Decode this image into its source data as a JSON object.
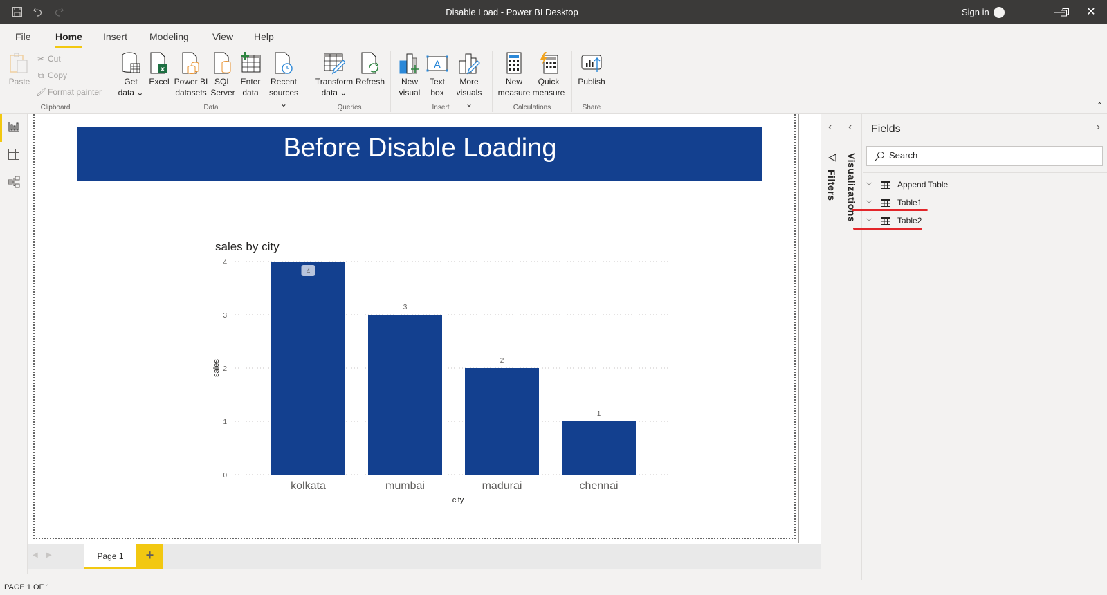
{
  "app": {
    "window_title": "Disable Load - Power BI Desktop",
    "sign_in": "Sign in",
    "quick_access": [
      "save-icon",
      "undo-icon",
      "redo-icon"
    ],
    "window_controls": {
      "minimize": "—",
      "restore": "❐",
      "close": "✕"
    }
  },
  "menu_tabs": [
    {
      "label": "File",
      "active": false
    },
    {
      "label": "Home",
      "active": true
    },
    {
      "label": "Insert",
      "active": false
    },
    {
      "label": "Modeling",
      "active": false
    },
    {
      "label": "View",
      "active": false
    },
    {
      "label": "Help",
      "active": false
    }
  ],
  "ribbon": {
    "clipboard": {
      "group_label": "Clipboard",
      "paste": "Paste",
      "cut": "Cut",
      "copy": "Copy",
      "format_painter": "Format painter"
    },
    "data": {
      "group_label": "Data",
      "buttons": [
        {
          "line1": "Get",
          "line2": "data ⌄"
        },
        {
          "line1": "Excel",
          "line2": ""
        },
        {
          "line1": "Power BI",
          "line2": "datasets"
        },
        {
          "line1": "SQL",
          "line2": "Server"
        },
        {
          "line1": "Enter",
          "line2": "data"
        },
        {
          "line1": "Recent",
          "line2": "sources ⌄"
        }
      ]
    },
    "queries": {
      "group_label": "Queries",
      "buttons": [
        {
          "line1": "Transform",
          "line2": "data ⌄"
        },
        {
          "line1": "Refresh",
          "line2": ""
        }
      ]
    },
    "insert": {
      "group_label": "Insert",
      "buttons": [
        {
          "line1": "New",
          "line2": "visual"
        },
        {
          "line1": "Text",
          "line2": "box"
        },
        {
          "line1": "More",
          "line2": "visuals ⌄"
        }
      ]
    },
    "calculations": {
      "group_label": "Calculations",
      "buttons": [
        {
          "line1": "New",
          "line2": "measure"
        },
        {
          "line1": "Quick",
          "line2": "measure"
        }
      ]
    },
    "share": {
      "group_label": "Share",
      "buttons": [
        {
          "line1": "Publish",
          "line2": ""
        }
      ]
    },
    "collapse": "⌃"
  },
  "left_nav": [
    "report-view-icon",
    "data-view-icon",
    "model-view-icon"
  ],
  "canvas": {
    "banner_text": "Before Disable Loading",
    "banner_color": "#13408f"
  },
  "chart_data": {
    "type": "bar",
    "title": "sales by city",
    "categories": [
      "kolkata",
      "mumbai",
      "madurai",
      "chennai"
    ],
    "values": [
      4,
      3,
      2,
      1
    ],
    "data_labels": [
      "4",
      "3",
      "2",
      "1"
    ],
    "xlabel": "city",
    "ylabel": "sales",
    "ylim": [
      0,
      4
    ],
    "yticks": [
      0,
      1,
      2,
      3,
      4
    ],
    "grid": true,
    "bar_color": "#13408f",
    "highlighted_label_index": 0
  },
  "pages": {
    "tabs": [
      "Page 1"
    ],
    "add": "+",
    "status": "PAGE 1 OF 1"
  },
  "panes": {
    "filters_label": "Filters",
    "visualizations_label": "Visualizations",
    "fields": {
      "title": "Fields",
      "search_placeholder": "Search",
      "tables": [
        {
          "name": "Append Table",
          "underlined": false
        },
        {
          "name": "Table1",
          "underlined": true
        },
        {
          "name": "Table2",
          "underlined": true
        }
      ],
      "annotation_color": "#e2262a"
    }
  }
}
